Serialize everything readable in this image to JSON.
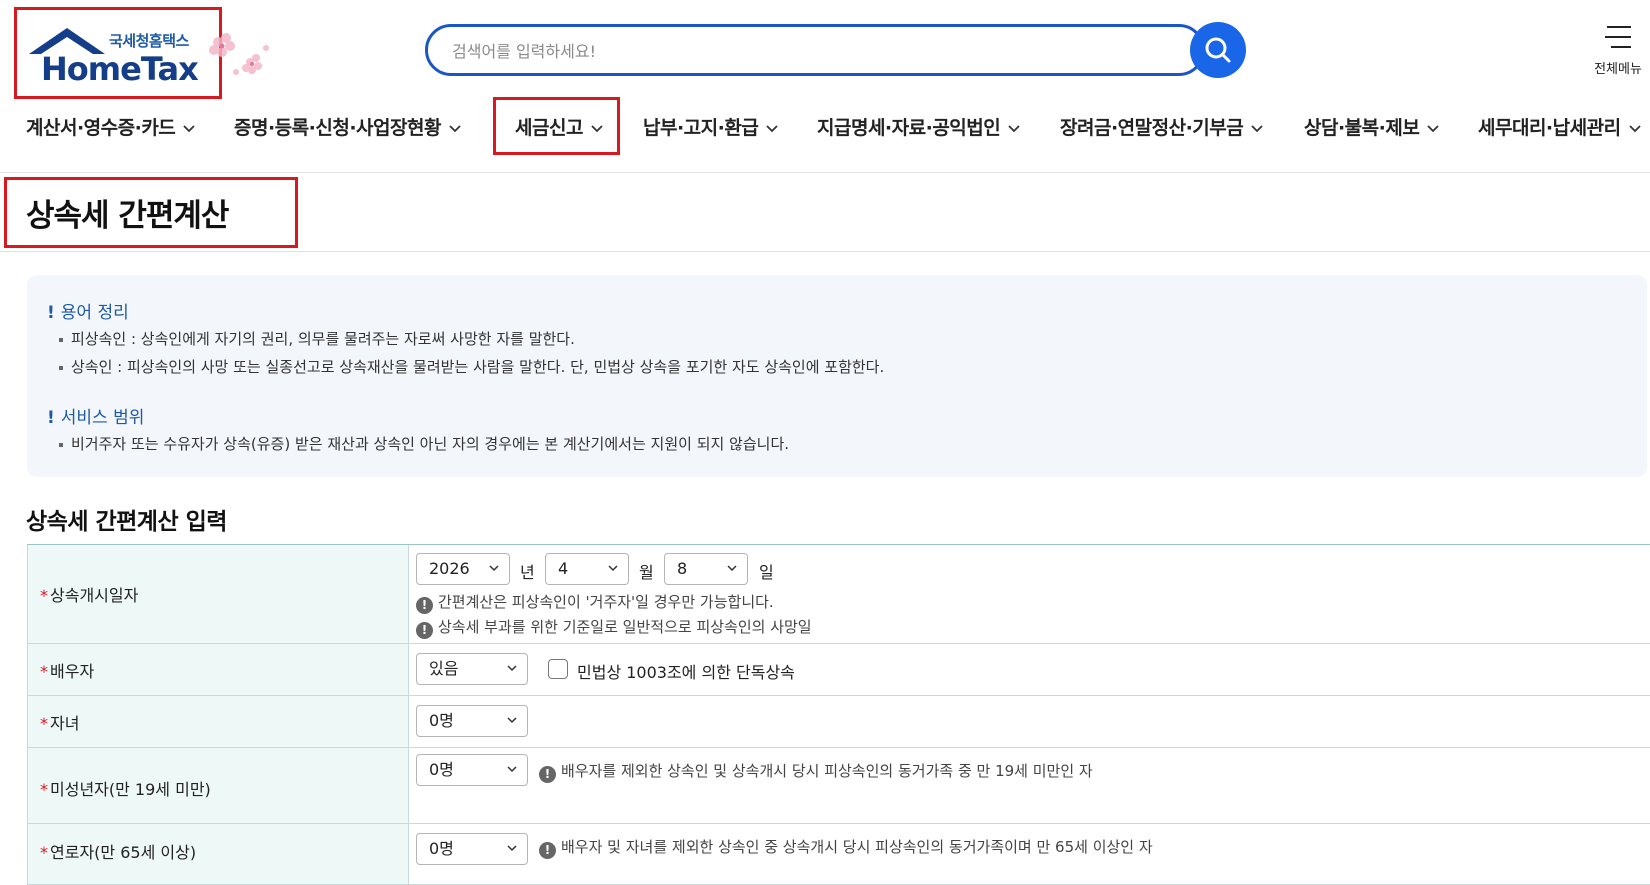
{
  "header": {
    "logo_kr": "국세청홈택스",
    "logo_en": "HomeTax",
    "search_placeholder": "검색어를 입력하세요!",
    "all_menu_label": "전체메뉴"
  },
  "nav": {
    "items": [
      {
        "label": "계산서·영수증·카드"
      },
      {
        "label": "증명·등록·신청·사업장현황"
      },
      {
        "label": "세금신고"
      },
      {
        "label": "납부·고지·환급"
      },
      {
        "label": "지급명세·자료·공익법인"
      },
      {
        "label": "장려금·연말정산·기부금"
      },
      {
        "label": "상담·불복·제보"
      },
      {
        "label": "세무대리·납세관리"
      }
    ],
    "active_index": 2
  },
  "page": {
    "title": "상속세 간편계산"
  },
  "info": {
    "terms_heading": "용어 정리",
    "terms": [
      "피상속인 : 상속인에게 자기의 권리, 의무를 물려주는 자로써 사망한 자를 말한다.",
      "상속인 : 피상속인의 사망 또는 실종선고로 상속재산을 물려받는 사람을 말한다. 단, 민법상 상속을 포기한 자도 상속인에 포함한다."
    ],
    "scope_heading": "서비스 범위",
    "scope": [
      "비거주자 또는 수유자가 상속(유증) 받은 재산과 상속인 아닌 자의 경우에는 본 계산기에서는 지원이 되지 않습니다."
    ]
  },
  "form": {
    "section_title": "상속세 간편계산 입력",
    "start_date": {
      "label": "상속개시일자",
      "year": "2026",
      "year_unit": "년",
      "month": "4",
      "month_unit": "월",
      "day": "8",
      "day_unit": "일",
      "note1": "간편계산은 피상속인이 '거주자'일 경우만 가능합니다.",
      "note2": "상속세 부과를 위한 기준일로 일반적으로 피상속인의 사망일"
    },
    "spouse": {
      "label": "배우자",
      "value": "있음",
      "checkbox_label": "민법상 1003조에 의한 단독상속"
    },
    "children": {
      "label": "자녀",
      "value": "0명"
    },
    "minors": {
      "label": "미성년자(만 19세 미만)",
      "value": "0명",
      "note": "배우자를 제외한 상속인 및 상속개시 당시 피상속인의 동거가족 중 만 19세 미만인 자"
    },
    "elderly": {
      "label": "연로자(만 65세 이상)",
      "value": "0명",
      "note": "배우자 및 자녀를 제외한 상속인 중 상속개시 당시 피상속인의 동거가족이며 만 65세 이상인 자"
    }
  },
  "colors": {
    "highlight_red": "#d71920",
    "brand_blue": "#1a55c9",
    "required_star": "#d71920"
  }
}
